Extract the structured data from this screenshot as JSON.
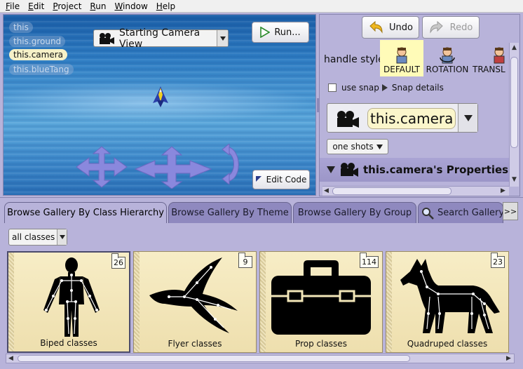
{
  "menu": {
    "items": [
      {
        "key": "F",
        "rest": "ile"
      },
      {
        "key": "E",
        "rest": "dit"
      },
      {
        "key": "P",
        "rest": "roject"
      },
      {
        "key": "R",
        "rest": "un"
      },
      {
        "key": "W",
        "rest": "indow"
      },
      {
        "key": "H",
        "rest": "elp"
      }
    ]
  },
  "scene": {
    "objects": [
      {
        "label": "this",
        "state": "dim"
      },
      {
        "label": "this.ground",
        "state": "dim"
      },
      {
        "label": "this.camera",
        "state": "active"
      },
      {
        "label": "this.blueTang",
        "state": "dim"
      }
    ],
    "camera_view_label": "Starting Camera View",
    "run_label": "Run...",
    "run_key": "R",
    "edit_code_label": "Edit Code"
  },
  "toolbar": {
    "undo_label": "Undo",
    "redo_label": "Redo"
  },
  "handles": {
    "label": "handle style:",
    "styles": [
      {
        "label": "DEFAULT",
        "selected": true
      },
      {
        "label": "ROTATION",
        "selected": false
      },
      {
        "label": "TRANSL",
        "selected": false
      }
    ]
  },
  "snap": {
    "use_snap_label": "use snap",
    "details_label": "Snap details"
  },
  "selected_object": {
    "name": "this.camera",
    "one_shots_label": "one shots",
    "properties_label": "this.camera's Properties"
  },
  "gallery": {
    "tabs": [
      {
        "label": "Browse Gallery By Class Hierarchy",
        "active": true
      },
      {
        "label": "Browse Gallery By Theme",
        "active": false
      },
      {
        "label": "Browse Gallery By Group",
        "active": false
      },
      {
        "label": "Search Gallery",
        "active": false
      }
    ],
    "more_label": ">>",
    "class_filter": "all classes",
    "cards": [
      {
        "label": "Biped classes",
        "count": "26"
      },
      {
        "label": "Flyer classes",
        "count": "9"
      },
      {
        "label": "Prop classes",
        "count": "114"
      },
      {
        "label": "Quadruped classes",
        "count": "23"
      }
    ]
  },
  "colors": {
    "panel": "#b8b3da",
    "card": "#f2e6b8",
    "selected_style": "#fffbb8"
  }
}
